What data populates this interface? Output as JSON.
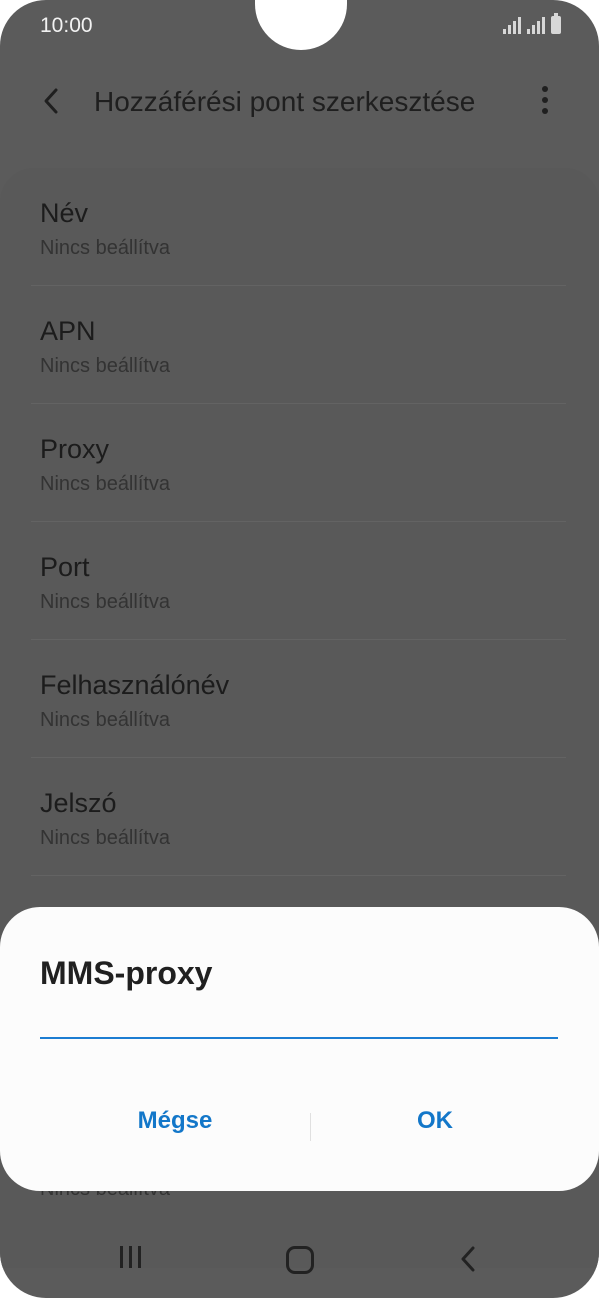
{
  "status_bar": {
    "time": "10:00"
  },
  "app_bar": {
    "title": "Hozzáférési pont szerkesztése"
  },
  "list": {
    "items": [
      {
        "title": "Név",
        "subtitle": "Nincs beállítva"
      },
      {
        "title": "APN",
        "subtitle": "Nincs beállítva"
      },
      {
        "title": "Proxy",
        "subtitle": "Nincs beállítva"
      },
      {
        "title": "Port",
        "subtitle": "Nincs beállítva"
      },
      {
        "title": "Felhasználónév",
        "subtitle": "Nincs beállítva"
      },
      {
        "title": "Jelszó",
        "subtitle": "Nincs beállítva"
      }
    ],
    "partial_subtitle": "Nincs beállítva"
  },
  "dialog": {
    "title": "MMS-proxy",
    "input_value": "",
    "cancel_label": "Mégse",
    "ok_label": "OK",
    "accent_color": "#1377c9"
  },
  "icons": {
    "back": "back-arrow-icon",
    "more": "more-vertical-icon",
    "signal": "signal-icon",
    "battery": "battery-icon",
    "nav_recent": "recent-apps-icon",
    "nav_home": "home-icon",
    "nav_back": "nav-back-icon"
  }
}
